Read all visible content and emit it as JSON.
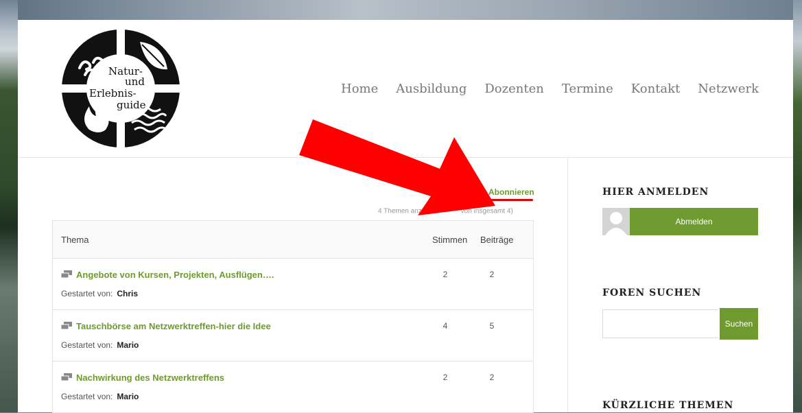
{
  "site": {
    "logo_text": [
      "Natur-",
      "und",
      "Erlebnis-",
      "guide"
    ]
  },
  "nav": [
    "Home",
    "Ausbildung",
    "Dozenten",
    "Termine",
    "Kontakt",
    "Netzwerk"
  ],
  "forum": {
    "subscribe_label": "Abonnieren",
    "count_text_left": "4 Themen anzeige",
    "count_text_right": "von insgesamt 4)",
    "columns": {
      "topic": "Thema",
      "votes": "Stimmen",
      "posts": "Beiträge"
    },
    "started_by_label": "Gestartet von:",
    "topics": [
      {
        "title": "Angebote von Kursen, Projekten, Ausflügen….",
        "author": "Chris",
        "votes": "2",
        "posts": "2"
      },
      {
        "title": "Tauschbörse am Netzwerktreffen-hier die Idee",
        "author": "Mario",
        "votes": "4",
        "posts": "5"
      },
      {
        "title": "Nachwirkung des Netzwerktreffens",
        "author": "Mario",
        "votes": "2",
        "posts": "2"
      }
    ]
  },
  "sidebar": {
    "login_heading": "HIER ANMELDEN",
    "logout_label": "Abmelden",
    "search_heading": "FOREN SUCHEN",
    "search_button": "Suchen",
    "search_value": "",
    "recent_heading": "KÜRZLICHE THEMEN"
  },
  "colors": {
    "accent": "#6f9a2f",
    "arrow": "#ff0000"
  }
}
